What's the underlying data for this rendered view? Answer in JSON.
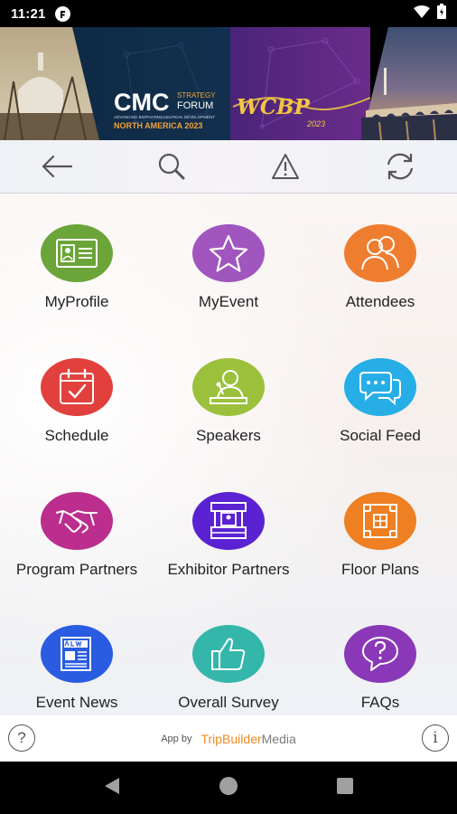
{
  "status_bar": {
    "time": "11:21"
  },
  "banner": {
    "cmc_text": "CMC",
    "strategy_text": "STRATEGY",
    "forum_text": "FORUM",
    "tagline": "ADVANCING BIOPHARMACEUTICAL DEVELOPMENT",
    "region_text": "NORTH AMERICA 2023",
    "wcbp_text": "WCBP",
    "wcbp_year": "2023"
  },
  "toolbar": {
    "back": "back-arrow-icon",
    "search": "search-icon",
    "alert": "warning-icon",
    "refresh": "refresh-icon"
  },
  "tiles": [
    {
      "label": "MyProfile",
      "color": "#6ba539",
      "icon": "profile-card-icon"
    },
    {
      "label": "MyEvent",
      "color": "#a056be",
      "icon": "star-icon"
    },
    {
      "label": "Attendees",
      "color": "#ef7d2f",
      "icon": "attendees-icon"
    },
    {
      "label": "Schedule",
      "color": "#e2403d",
      "icon": "calendar-check-icon"
    },
    {
      "label": "Speakers",
      "color": "#9bc13c",
      "icon": "speaker-podium-icon"
    },
    {
      "label": "Social Feed",
      "color": "#27aee6",
      "icon": "chat-bubbles-icon"
    },
    {
      "label": "Program Partners",
      "color": "#bb2e8d",
      "icon": "handshake-icon"
    },
    {
      "label": "Exhibitor Partners",
      "color": "#5a22d2",
      "icon": "booth-icon"
    },
    {
      "label": "Floor Plans",
      "color": "#ee7f22",
      "icon": "floor-plan-icon"
    },
    {
      "label": "Event News",
      "color": "#2a5ce2",
      "icon": "newspaper-icon"
    },
    {
      "label": "Overall Survey",
      "color": "#35b6ab",
      "icon": "thumbs-up-icon"
    },
    {
      "label": "FAQs",
      "color": "#8a38b8",
      "icon": "question-bubble-icon"
    }
  ],
  "footer": {
    "app_by": "App by",
    "brand_part1": "TripBuilder",
    "brand_part2": "Media",
    "brand_color": "#f08a1c"
  }
}
